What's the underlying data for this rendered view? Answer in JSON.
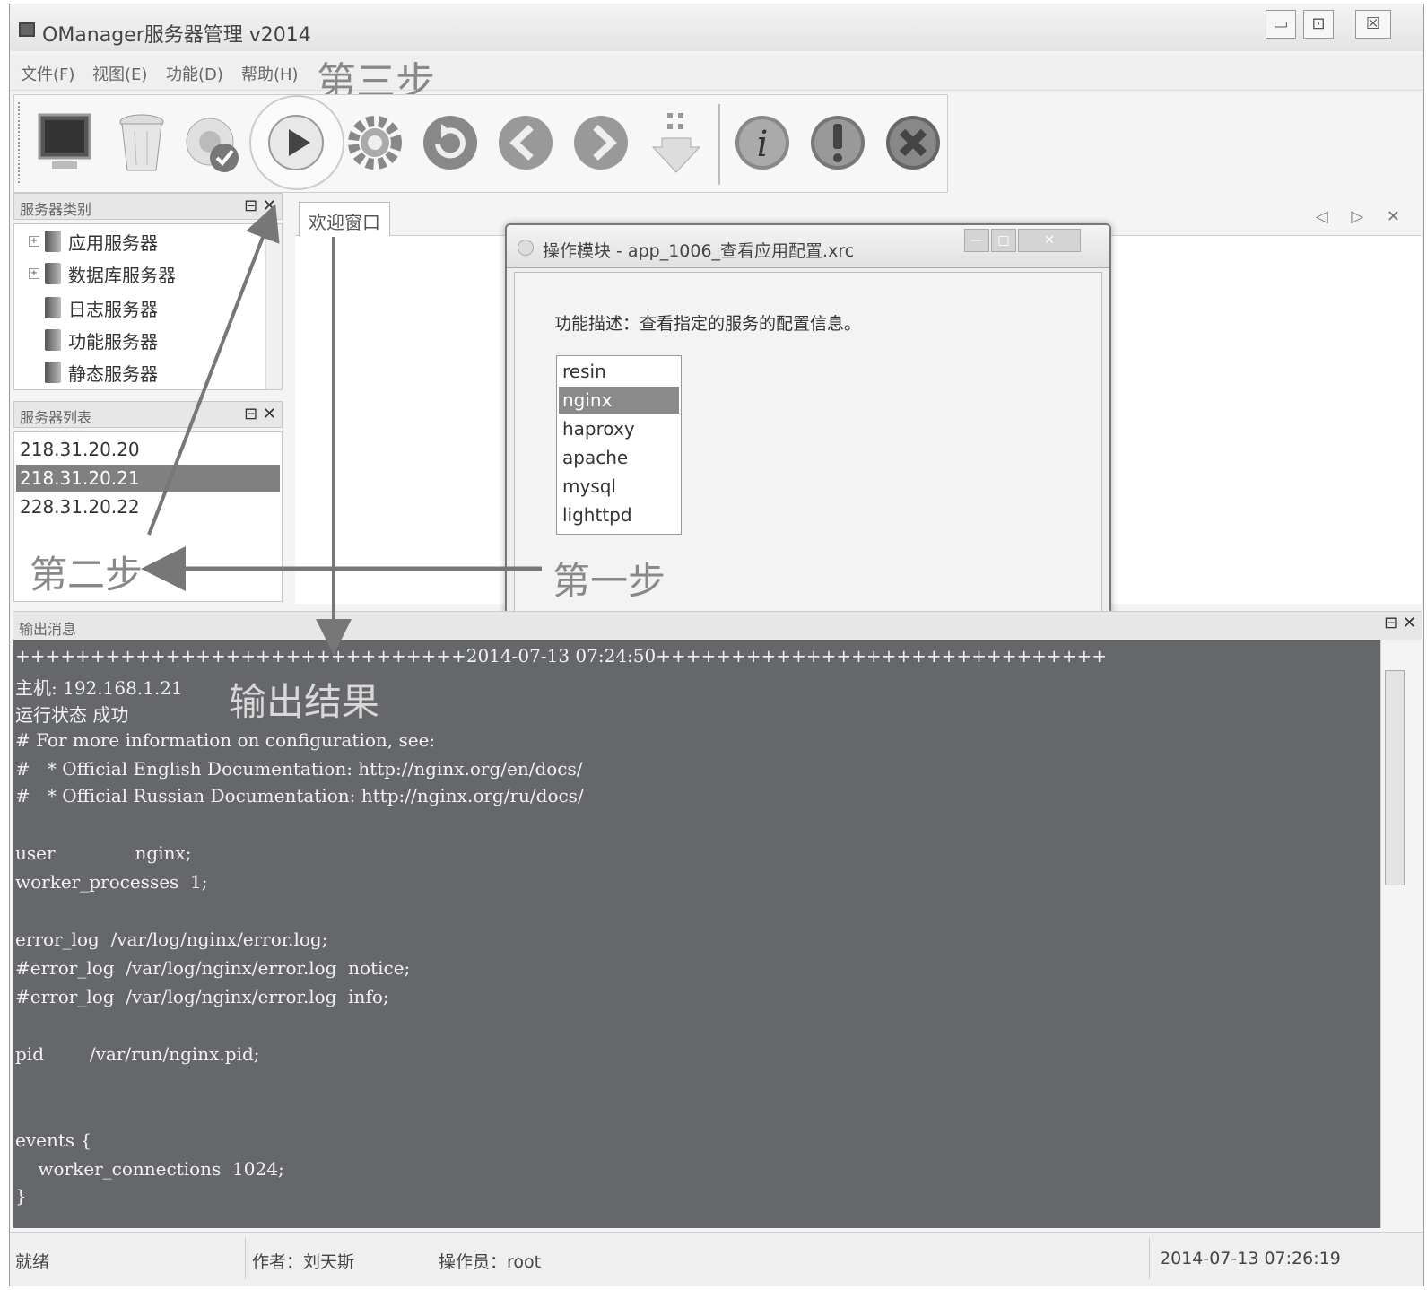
{
  "window": {
    "title": "OManager服务器管理 v2014",
    "controls": {
      "minimize": "▭",
      "maximize": "⊡",
      "close": "☒"
    }
  },
  "menu": [
    "文件(F)",
    "视图(E)",
    "功能(D)",
    "帮助(H)"
  ],
  "annotations": {
    "step1": "第一步",
    "step2": "第二步",
    "step3": "第三步",
    "result": "输出结果"
  },
  "toolbar": {
    "icons": [
      "monitor-icon",
      "trash-icon",
      "check-icon",
      "play-icon",
      "gear-icon",
      "refresh-icon",
      "back-icon",
      "forward-icon",
      "download-icon",
      "info-icon",
      "warning-icon",
      "stop-icon"
    ]
  },
  "server_types": {
    "title": "服务器类别",
    "controls": "⊟ ✕",
    "items": [
      "应用服务器",
      "数据库服务器",
      "日志服务器",
      "功能服务器",
      "静态服务器"
    ]
  },
  "server_list": {
    "title": "服务器列表",
    "controls": "⊟ ✕",
    "items": [
      "218.31.20.20",
      "218.31.20.21",
      "228.31.20.22"
    ],
    "selected_index": 1
  },
  "tabs": {
    "active": "欢迎窗口",
    "controls": "◁ ▷ ✕"
  },
  "dialog": {
    "title": "操作模块 - app_1006_查看应用配置.xrc",
    "controls": {
      "minimize": "—",
      "maximize": "□",
      "close": "✕"
    },
    "description": "功能描述：查看指定的服务的配置信息。",
    "services": [
      "resin",
      "nginx",
      "haproxy",
      "apache",
      "mysql",
      "lighttpd"
    ],
    "selected_index": 1
  },
  "output": {
    "title": "输出消息",
    "controls": "⊟ ✕",
    "lines": [
      "++++++++++++++++++++++++++++++2014-07-13 07:24:50++++++++++++++++++++++++++++++",
      "主机: 192.168.1.21",
      "运行状态 成功",
      "# For more information on configuration, see:",
      "#   * Official English Documentation: http://nginx.org/en/docs/",
      "#   * Official Russian Documentation: http://nginx.org/ru/docs/",
      "",
      "user              nginx;",
      "worker_processes  1;",
      "",
      "error_log  /var/log/nginx/error.log;",
      "#error_log  /var/log/nginx/error.log  notice;",
      "#error_log  /var/log/nginx/error.log  info;",
      "",
      "pid        /var/run/nginx.pid;",
      "",
      "",
      "events {",
      "    worker_connections  1024;",
      "}"
    ]
  },
  "status": {
    "state": "就绪",
    "author": "作者：刘天斯",
    "operator": "操作员：root",
    "datetime": "2014-07-13 07:26:19"
  }
}
